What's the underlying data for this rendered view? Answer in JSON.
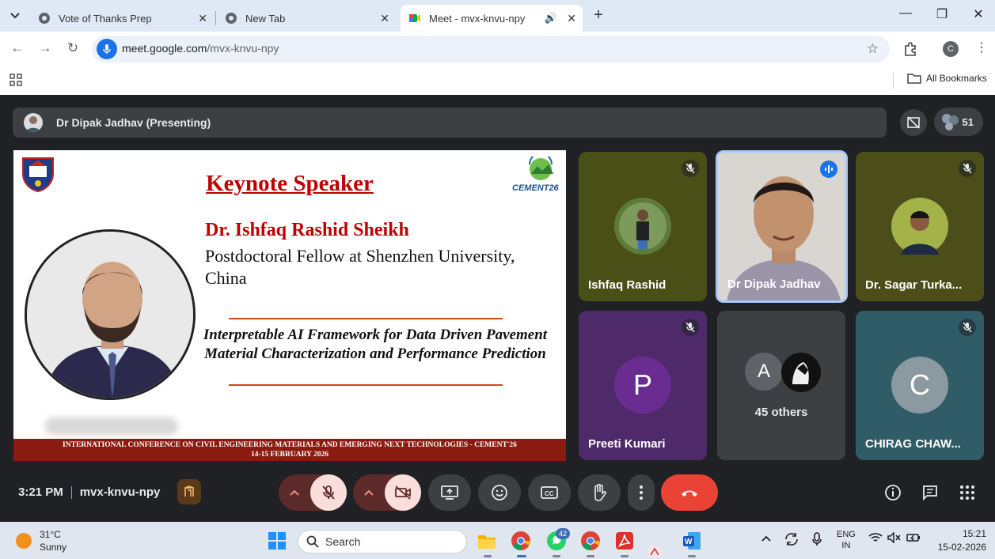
{
  "browser": {
    "tabs": [
      {
        "title": "Vote of Thanks Prep",
        "active": false
      },
      {
        "title": "New Tab",
        "active": false
      },
      {
        "title": "Meet - mvx-knvu-npy",
        "active": true
      }
    ],
    "url_host": "meet.google.com",
    "url_path": "/mvx-knvu-npy",
    "profile_initial": "C",
    "all_bookmarks_label": "All Bookmarks"
  },
  "meet": {
    "presenter_label": "Dr Dipak Jadhav (Presenting)",
    "participant_count": "51",
    "slide": {
      "title": "Keynote Speaker",
      "cement_logo_text": "CEMENT26",
      "speaker_name": "Dr. Ishfaq Rashid Sheikh",
      "speaker_affiliation": "Postdoctoral Fellow at Shenzhen University, China",
      "talk_title": "Interpretable AI Framework for Data Driven Pavement Material Characterization and Performance Prediction",
      "footer_line1": "INTERNATIONAL CONFERENCE ON CIVIL ENGINEERING MATERIALS AND EMERGING NEXT TECHNOLOGIES - CEMENT'26",
      "footer_line2": "14-15 FEBRUARY 2026"
    },
    "tiles": [
      {
        "name": "Ishfaq Rashid",
        "muted": true
      },
      {
        "name": "Dr Dipak Jadhav",
        "muted": false,
        "speaking": true
      },
      {
        "name": "Dr. Sagar Turka...",
        "muted": true
      },
      {
        "name": "Preeti Kumari",
        "initial": "P",
        "muted": true
      },
      {
        "others_label": "45 others",
        "initial": "A"
      },
      {
        "name": "CHIRAG CHAW...",
        "initial": "C",
        "muted": true
      }
    ],
    "time": "3:21 PM",
    "meeting_code": "mvx-knvu-npy"
  },
  "taskbar": {
    "temperature": "31°C",
    "weather": "Sunny",
    "search_label": "Search",
    "whatsapp_badge": "42",
    "lang_line1": "ENG",
    "lang_line2": "IN",
    "clock": "15:21",
    "date": "15-02-2026"
  },
  "colors": {
    "meet_bg": "#202124",
    "tile_dark": "#3c4043",
    "end_call": "#ea4335",
    "slide_red": "#c00000",
    "footer_maroon": "#8b1a10"
  }
}
